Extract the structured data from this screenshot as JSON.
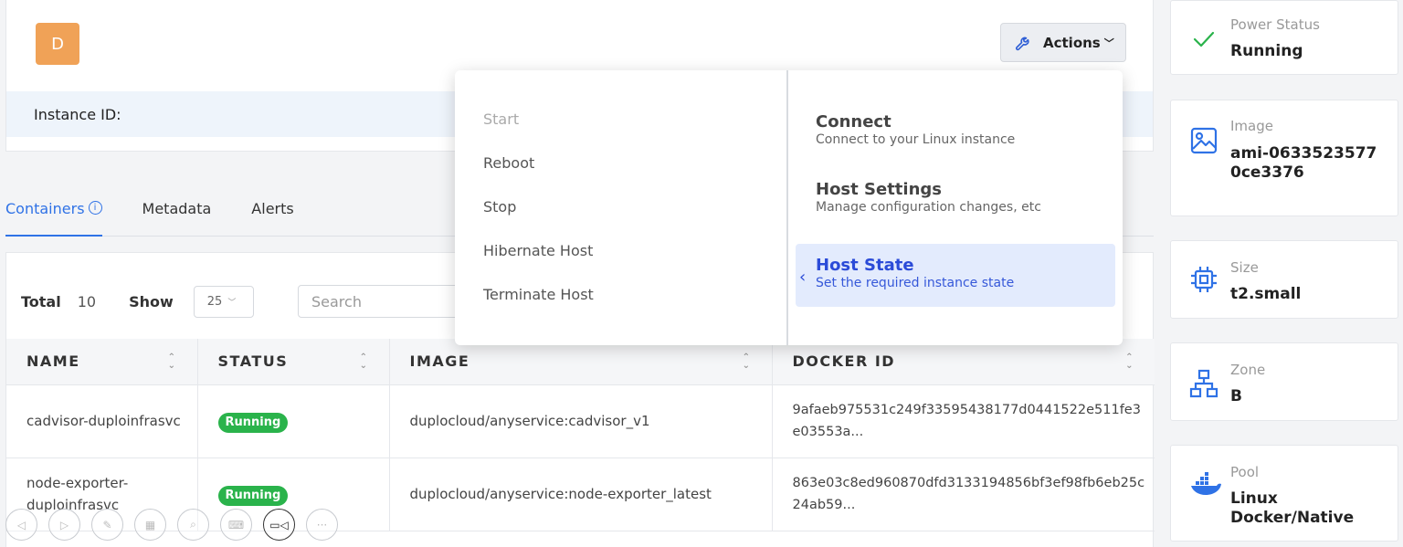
{
  "header": {
    "avatar_letter": "D",
    "actions_label": "Actions",
    "instance_id_label": "Instance ID:"
  },
  "tabs": [
    {
      "label": "Containers",
      "active": true
    },
    {
      "label": "Metadata"
    },
    {
      "label": "Alerts"
    }
  ],
  "toolbar": {
    "total_label": "Total",
    "total_value": "10",
    "show_label": "Show",
    "page_size": "25",
    "search_placeholder": "Search"
  },
  "table": {
    "columns": [
      "NAME",
      "STATUS",
      "IMAGE",
      "DOCKER ID"
    ],
    "rows": [
      {
        "name": "cadvisor-duploinfrasvc",
        "status": "Running",
        "image": "duplocloud/anyservice:cadvisor_v1",
        "docker_id": "9afaeb975531c249f33595438177d0441522e511fe3e03553a..."
      },
      {
        "name": "node-exporter-duploinfrasvc",
        "status": "Running",
        "image": "duplocloud/anyservice:node-exporter_latest",
        "docker_id": "863e03c8ed960870dfd3133194856bf3ef98fb6eb25c24ab59..."
      }
    ]
  },
  "dropdown": {
    "left_items": [
      {
        "label": "Start",
        "disabled": true
      },
      {
        "label": "Reboot"
      },
      {
        "label": "Stop"
      },
      {
        "label": "Hibernate Host"
      },
      {
        "label": "Terminate Host"
      }
    ],
    "right_options": [
      {
        "title": "Connect",
        "subtitle": "Connect to your Linux instance"
      },
      {
        "title": "Host Settings",
        "subtitle": "Manage configuration changes, etc"
      },
      {
        "title": "Host State",
        "subtitle": "Set the required instance state",
        "active": true
      }
    ]
  },
  "side_cards": {
    "power": {
      "label": "Power Status",
      "value": "Running",
      "icon": "check-icon"
    },
    "image": {
      "label": "Image",
      "value": "ami-06335235770ce3376",
      "icon": "image-icon"
    },
    "size": {
      "label": "Size",
      "value": "t2.small",
      "icon": "cpu-icon"
    },
    "zone": {
      "label": "Zone",
      "value": "B",
      "icon": "network-icon"
    },
    "pool": {
      "label": "Pool",
      "value": "Linux Docker/Native",
      "icon": "docker-icon"
    }
  },
  "colors": {
    "accent": "#2f72e6",
    "running": "#2ab34b",
    "avatar": "#f0a257"
  }
}
